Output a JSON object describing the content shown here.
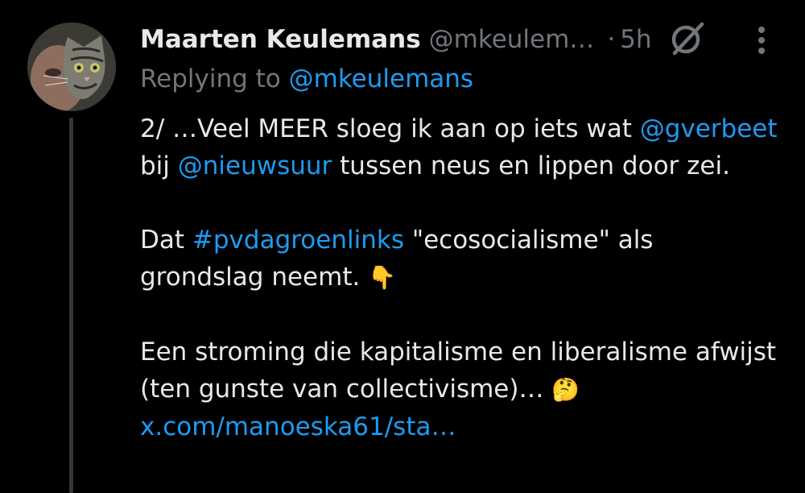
{
  "tweet": {
    "author_name": "Maarten Keulemans",
    "author_handle": "@mkeulem…",
    "separator": "·",
    "time": "5h",
    "replying_prefix": "Replying to ",
    "replying_to": "@mkeulemans",
    "paragraph1": {
      "t1": "2/ …Veel MEER sloeg ik aan op iets wat ",
      "mention1": "@gverbeet",
      "t2": " bij ",
      "mention2": "@nieuwsuur",
      "t3": " tussen neus en lippen door zei."
    },
    "paragraph2": {
      "t1": "Dat ",
      "hashtag": "#pvdagroenlinks",
      "t2": " \"ecosocialisme\" als grondslag neemt. ",
      "emoji": "👇"
    },
    "paragraph3": {
      "t1": "Een stroming die kapitalisme en liberalisme afwijst (ten gunste van collectivisme)… ",
      "emoji": "🤔",
      "link": "x.com/manoeska61/sta…"
    }
  },
  "icons": {
    "avatar": "avatar-cat-photo",
    "grok": "grok-icon",
    "more": "more-vertical-icon"
  },
  "colors": {
    "background": "#000000",
    "text": "#e7e9ea",
    "secondary": "#71767b",
    "link": "#1d9bf0",
    "thread_line": "#333639"
  }
}
